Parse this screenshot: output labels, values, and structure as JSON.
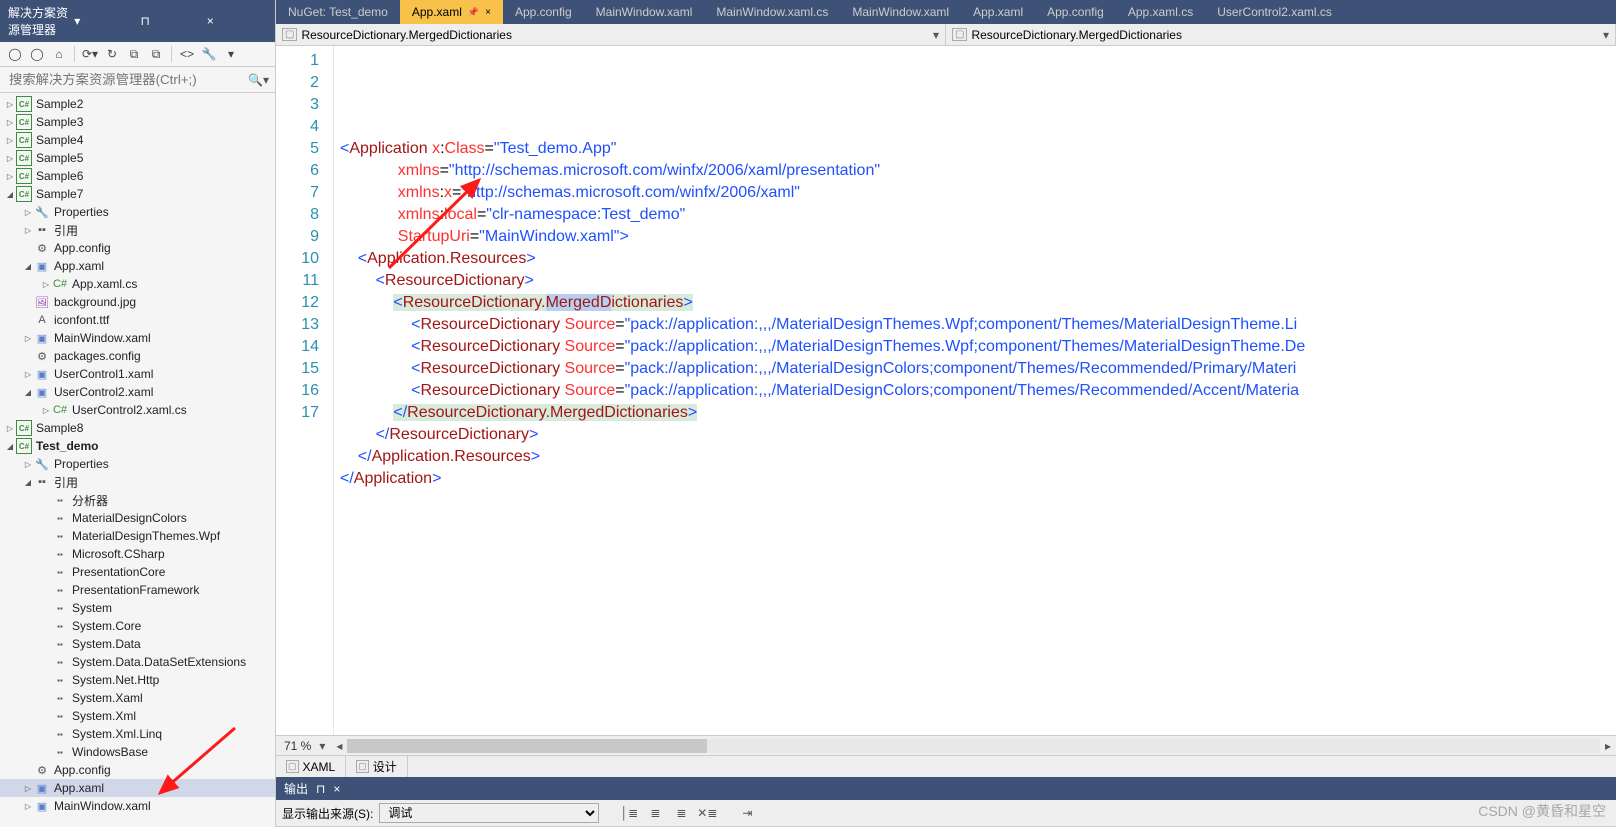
{
  "sidebar": {
    "title": "解决方案资源管理器",
    "search_placeholder": "搜索解决方案资源管理器(Ctrl+;)"
  },
  "tree": [
    {
      "d": 0,
      "a": "closed",
      "i": "csharp",
      "t": "Sample2"
    },
    {
      "d": 0,
      "a": "closed",
      "i": "csharp",
      "t": "Sample3"
    },
    {
      "d": 0,
      "a": "closed",
      "i": "csharp",
      "t": "Sample4"
    },
    {
      "d": 0,
      "a": "closed",
      "i": "csharp",
      "t": "Sample5"
    },
    {
      "d": 0,
      "a": "closed",
      "i": "csharp",
      "t": "Sample6"
    },
    {
      "d": 0,
      "a": "open",
      "i": "csharp",
      "t": "Sample7"
    },
    {
      "d": 1,
      "a": "closed",
      "i": "wrench",
      "t": "Properties"
    },
    {
      "d": 1,
      "a": "closed",
      "i": "refs",
      "t": "引用"
    },
    {
      "d": 1,
      "a": "none",
      "i": "cfg",
      "t": "App.config"
    },
    {
      "d": 1,
      "a": "open",
      "i": "xaml",
      "t": "App.xaml"
    },
    {
      "d": 2,
      "a": "closed",
      "i": "csfile",
      "t": "App.xaml.cs"
    },
    {
      "d": 1,
      "a": "none",
      "i": "img",
      "t": "background.jpg"
    },
    {
      "d": 1,
      "a": "none",
      "i": "font",
      "t": "iconfont.ttf"
    },
    {
      "d": 1,
      "a": "closed",
      "i": "xaml",
      "t": "MainWindow.xaml"
    },
    {
      "d": 1,
      "a": "none",
      "i": "cfg",
      "t": "packages.config"
    },
    {
      "d": 1,
      "a": "closed",
      "i": "xaml",
      "t": "UserControl1.xaml"
    },
    {
      "d": 1,
      "a": "open",
      "i": "xaml",
      "t": "UserControl2.xaml"
    },
    {
      "d": 2,
      "a": "closed",
      "i": "csfile",
      "t": "UserControl2.xaml.cs"
    },
    {
      "d": 0,
      "a": "closed",
      "i": "csharp",
      "t": "Sample8"
    },
    {
      "d": 0,
      "a": "open",
      "i": "csharp",
      "t": "Test_demo",
      "b": true
    },
    {
      "d": 1,
      "a": "closed",
      "i": "wrench",
      "t": "Properties"
    },
    {
      "d": 1,
      "a": "open",
      "i": "refs",
      "t": "引用"
    },
    {
      "d": 2,
      "a": "none",
      "i": "asm",
      "t": "分析器"
    },
    {
      "d": 2,
      "a": "none",
      "i": "asm",
      "t": "MaterialDesignColors"
    },
    {
      "d": 2,
      "a": "none",
      "i": "asm",
      "t": "MaterialDesignThemes.Wpf"
    },
    {
      "d": 2,
      "a": "none",
      "i": "asm",
      "t": "Microsoft.CSharp"
    },
    {
      "d": 2,
      "a": "none",
      "i": "asm",
      "t": "PresentationCore"
    },
    {
      "d": 2,
      "a": "none",
      "i": "asm",
      "t": "PresentationFramework"
    },
    {
      "d": 2,
      "a": "none",
      "i": "asm",
      "t": "System"
    },
    {
      "d": 2,
      "a": "none",
      "i": "asm",
      "t": "System.Core"
    },
    {
      "d": 2,
      "a": "none",
      "i": "asm",
      "t": "System.Data"
    },
    {
      "d": 2,
      "a": "none",
      "i": "asm",
      "t": "System.Data.DataSetExtensions"
    },
    {
      "d": 2,
      "a": "none",
      "i": "asm",
      "t": "System.Net.Http"
    },
    {
      "d": 2,
      "a": "none",
      "i": "asm",
      "t": "System.Xaml"
    },
    {
      "d": 2,
      "a": "none",
      "i": "asm",
      "t": "System.Xml"
    },
    {
      "d": 2,
      "a": "none",
      "i": "asm",
      "t": "System.Xml.Linq"
    },
    {
      "d": 2,
      "a": "none",
      "i": "asm",
      "t": "WindowsBase"
    },
    {
      "d": 1,
      "a": "none",
      "i": "cfg",
      "t": "App.config"
    },
    {
      "d": 1,
      "a": "closed",
      "i": "xaml",
      "t": "App.xaml",
      "sel": true
    },
    {
      "d": 1,
      "a": "closed",
      "i": "xaml",
      "t": "MainWindow.xaml"
    }
  ],
  "tabs": [
    {
      "t": "NuGet: Test_demo"
    },
    {
      "t": "App.xaml",
      "active": true,
      "pin": true,
      "close": true
    },
    {
      "t": "App.config"
    },
    {
      "t": "MainWindow.xaml"
    },
    {
      "t": "MainWindow.xaml.cs"
    },
    {
      "t": "MainWindow.xaml"
    },
    {
      "t": "App.xaml"
    },
    {
      "t": "App.config"
    },
    {
      "t": "App.xaml.cs"
    },
    {
      "t": "UserControl2.xaml.cs"
    }
  ],
  "breadcrumb": {
    "left": "ResourceDictionary.MergedDictionaries",
    "right": "ResourceDictionary.MergedDictionaries"
  },
  "code": {
    "lines": [
      [
        {
          "c": "t-punct",
          "s": "<"
        },
        {
          "c": "t-tag",
          "s": "Application "
        },
        {
          "c": "t-attr",
          "s": "x"
        },
        {
          "c": "t-text",
          "s": ":"
        },
        {
          "c": "t-attr",
          "s": "Class"
        },
        {
          "c": "t-text",
          "s": "="
        },
        {
          "c": "t-punct",
          "s": "\""
        },
        {
          "c": "t-val",
          "s": "Test_demo.App"
        },
        {
          "c": "t-punct",
          "s": "\""
        }
      ],
      [
        {
          "c": "",
          "s": "             "
        },
        {
          "c": "t-attr",
          "s": "xmlns"
        },
        {
          "c": "t-text",
          "s": "="
        },
        {
          "c": "t-punct",
          "s": "\""
        },
        {
          "c": "t-val",
          "s": "http://schemas.microsoft.com/winfx/2006/xaml/presentation"
        },
        {
          "c": "t-punct",
          "s": "\""
        }
      ],
      [
        {
          "c": "",
          "s": "             "
        },
        {
          "c": "t-attr",
          "s": "xmlns"
        },
        {
          "c": "t-text",
          "s": ":"
        },
        {
          "c": "t-attr",
          "s": "x"
        },
        {
          "c": "t-text",
          "s": "="
        },
        {
          "c": "t-punct",
          "s": "\""
        },
        {
          "c": "t-val",
          "s": "http://schemas.microsoft.com/winfx/2006/xaml"
        },
        {
          "c": "t-punct",
          "s": "\""
        }
      ],
      [
        {
          "c": "",
          "s": "             "
        },
        {
          "c": "t-attr",
          "s": "xmlns"
        },
        {
          "c": "t-text",
          "s": ":"
        },
        {
          "c": "t-attr",
          "s": "local"
        },
        {
          "c": "t-text",
          "s": "="
        },
        {
          "c": "t-punct",
          "s": "\""
        },
        {
          "c": "t-val",
          "s": "clr-namespace:Test_demo"
        },
        {
          "c": "t-punct",
          "s": "\""
        }
      ],
      [
        {
          "c": "",
          "s": "             "
        },
        {
          "c": "t-attr",
          "s": "StartupUri"
        },
        {
          "c": "t-text",
          "s": "="
        },
        {
          "c": "t-punct",
          "s": "\""
        },
        {
          "c": "t-val",
          "s": "MainWindow.xaml"
        },
        {
          "c": "t-punct",
          "s": "\">"
        }
      ],
      [
        {
          "c": "",
          "s": "    "
        },
        {
          "c": "t-punct",
          "s": "<"
        },
        {
          "c": "t-tag",
          "s": "Application.Resources"
        },
        {
          "c": "t-punct",
          "s": ">"
        }
      ],
      [
        {
          "c": "",
          "s": "        "
        },
        {
          "c": "t-punct",
          "s": "<"
        },
        {
          "c": "t-tag",
          "s": "ResourceDictionary"
        },
        {
          "c": "t-punct",
          "s": ">"
        }
      ],
      [
        {
          "c": "",
          "s": "            "
        },
        {
          "c": "t-punct hl-bg",
          "s": "<"
        },
        {
          "c": "t-tag hl-bg",
          "s": "ResourceDictionary."
        },
        {
          "c": "t-tag hl-sel",
          "s": "MergedD"
        },
        {
          "c": "t-tag hl-bg",
          "s": "ictionaries"
        },
        {
          "c": "t-punct hl-bg",
          "s": ">"
        }
      ],
      [
        {
          "c": "",
          "s": "                "
        },
        {
          "c": "t-punct",
          "s": "<"
        },
        {
          "c": "t-tag",
          "s": "ResourceDictionary "
        },
        {
          "c": "t-attr",
          "s": "Source"
        },
        {
          "c": "t-text",
          "s": "="
        },
        {
          "c": "t-punct",
          "s": "\""
        },
        {
          "c": "t-val",
          "s": "pack://application:,,,/MaterialDesignThemes.Wpf;component/Themes/MaterialDesignTheme.Li"
        }
      ],
      [
        {
          "c": "",
          "s": "                "
        },
        {
          "c": "t-punct",
          "s": "<"
        },
        {
          "c": "t-tag",
          "s": "ResourceDictionary "
        },
        {
          "c": "t-attr",
          "s": "Source"
        },
        {
          "c": "t-text",
          "s": "="
        },
        {
          "c": "t-punct",
          "s": "\""
        },
        {
          "c": "t-val",
          "s": "pack://application:,,,/MaterialDesignThemes.Wpf;component/Themes/MaterialDesignTheme.De"
        }
      ],
      [
        {
          "c": "",
          "s": "                "
        },
        {
          "c": "t-punct",
          "s": "<"
        },
        {
          "c": "t-tag",
          "s": "ResourceDictionary "
        },
        {
          "c": "t-attr",
          "s": "Source"
        },
        {
          "c": "t-text",
          "s": "="
        },
        {
          "c": "t-punct",
          "s": "\""
        },
        {
          "c": "t-val",
          "s": "pack://application:,,,/MaterialDesignColors;component/Themes/Recommended/Primary/Materi"
        }
      ],
      [
        {
          "c": "",
          "s": "                "
        },
        {
          "c": "t-punct",
          "s": "<"
        },
        {
          "c": "t-tag",
          "s": "ResourceDictionary "
        },
        {
          "c": "t-attr",
          "s": "Source"
        },
        {
          "c": "t-text",
          "s": "="
        },
        {
          "c": "t-punct",
          "s": "\""
        },
        {
          "c": "t-val",
          "s": "pack://application:,,,/MaterialDesignColors;component/Themes/Recommended/Accent/Materia"
        }
      ],
      [
        {
          "c": "",
          "s": "            "
        },
        {
          "c": "t-punct hl-bg",
          "s": "</"
        },
        {
          "c": "t-tag hl-bg",
          "s": "ResourceDictionary.MergedDictionaries"
        },
        {
          "c": "t-punct hl-bg",
          "s": ">"
        }
      ],
      [
        {
          "c": "",
          "s": "        "
        },
        {
          "c": "t-punct",
          "s": "</"
        },
        {
          "c": "t-tag",
          "s": "ResourceDictionary"
        },
        {
          "c": "t-punct",
          "s": ">"
        }
      ],
      [
        {
          "c": "",
          "s": "    "
        },
        {
          "c": "t-punct",
          "s": "</"
        },
        {
          "c": "t-tag",
          "s": "Application.Resources"
        },
        {
          "c": "t-punct",
          "s": ">"
        }
      ],
      [
        {
          "c": "t-punct",
          "s": "</"
        },
        {
          "c": "t-tag",
          "s": "Application"
        },
        {
          "c": "t-punct",
          "s": ">"
        }
      ],
      [
        {
          "c": "",
          "s": " "
        }
      ]
    ]
  },
  "zoom": "71 %",
  "viewtabs": {
    "xaml": "XAML",
    "design": "设计"
  },
  "output": {
    "title": "输出",
    "source_label": "显示输出来源(S):",
    "source_value": "调试"
  },
  "watermark": "CSDN @黄昏和星空"
}
